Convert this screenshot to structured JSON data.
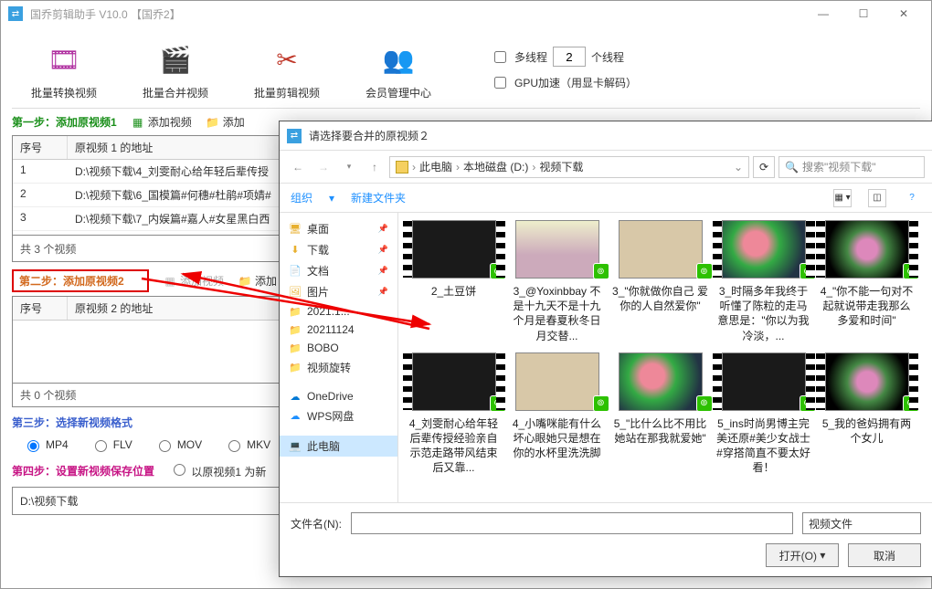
{
  "main_title": "国乔剪辑助手 V10.0   【国乔2】",
  "win_btns": {
    "min": "—",
    "max": "☐",
    "close": "✕"
  },
  "tools": [
    {
      "label": "批量转换视频",
      "icon": "🎞"
    },
    {
      "label": "批量合并视频",
      "icon": "🎬"
    },
    {
      "label": "批量剪辑视频",
      "icon": "✂"
    },
    {
      "label": "会员管理中心",
      "icon": "👥"
    }
  ],
  "options": {
    "multithread": "多线程",
    "thread_count": "2",
    "thread_unit": "个线程",
    "gpu": "GPU加速（用显卡解码）"
  },
  "step1": {
    "label": "第一步：添加原视频1",
    "add": "添加视频",
    "addfolder": "添加"
  },
  "table1": {
    "col_num": "序号",
    "col_addr": "原视频 1 的地址",
    "rows": [
      {
        "n": "1",
        "addr": "D:\\视频下载\\4_刘雯耐心给年轻后辈传授"
      },
      {
        "n": "2",
        "addr": "D:\\视频下载\\6_国模篇#何穗#杜鹃#项婧#"
      },
      {
        "n": "3",
        "addr": "D:\\视频下载\\7_内娱篇#嘉人#女星黑白西"
      }
    ],
    "footer": "共 3 个视频",
    "footer_chk": "添加"
  },
  "step2": {
    "label": "第二步：添加原视频2",
    "add": "添加视频",
    "addfolder": "添加"
  },
  "table2": {
    "col_num": "序号",
    "col_addr": "原视频 2 的地址",
    "footer": "共 0 个视频"
  },
  "step3": {
    "label": "第三步：选择新视频格式"
  },
  "formats": [
    "MP4",
    "FLV",
    "MOV",
    "MKV"
  ],
  "step4": {
    "label": "第四步：设置新视频保存位置",
    "opt": "以原视频1 为新"
  },
  "output_path": "D:\\视频下载",
  "dialog": {
    "title": "请选择要合并的原视频２",
    "crumbs": [
      "此电脑",
      "本地磁盘 (D:)",
      "视频下载"
    ],
    "search_placeholder": "搜索\"视频下载\"",
    "organize": "组织",
    "new_folder": "新建文件夹",
    "sidebar": [
      {
        "label": "桌面",
        "icon": "🖥",
        "pin": true
      },
      {
        "label": "下载",
        "icon": "⬇",
        "pin": true
      },
      {
        "label": "文档",
        "icon": "📄",
        "pin": true
      },
      {
        "label": "图片",
        "icon": "🖼",
        "pin": true
      },
      {
        "label": "2021.1...",
        "icon": "📁"
      },
      {
        "label": "20211124",
        "icon": "📁"
      },
      {
        "label": "BOBO",
        "icon": "📁"
      },
      {
        "label": "视频旋转",
        "icon": "📁"
      },
      {
        "label": "OneDrive",
        "icon": "☁",
        "cls": "si-onedrive",
        "gap": true
      },
      {
        "label": "WPS网盘",
        "icon": "☁",
        "cls": "si-wps"
      },
      {
        "label": "此电脑",
        "icon": "💻",
        "cls": "si-pc",
        "sel": true,
        "gap": true
      }
    ],
    "files": [
      {
        "name": "2_土豆饼",
        "cls": "dark"
      },
      {
        "name": "3_@Yoxinbbay 不是十九天不是十九个月是春夏秋冬日月交替...",
        "cls": "pink no-strip"
      },
      {
        "name": "3_\"你就做你自己 爱你的人自然爱你\"",
        "cls": "light no-strip"
      },
      {
        "name": "3_时隔多年我终于听懂了陈粒的走马意思是：\"你以为我冷淡，...",
        "cls": "flowers"
      },
      {
        "name": "4_\"你不能一句对不起就说带走我那么多爱和时间\"",
        "cls": "flowers2"
      },
      {
        "name": "4_刘雯耐心给年轻后辈传授经验亲自示范走路带风结束后又靠...",
        "cls": "dark"
      },
      {
        "name": "4_小嘴咪能有什么坏心眼她只是想在你的水杯里洗洗脚",
        "cls": "light no-strip"
      },
      {
        "name": "5_\"比什么比不用比她站在那我就爱她\"",
        "cls": "flowers no-strip"
      },
      {
        "name": "5_ins时尚男博主完美还原#美少女战士#穿搭简直不要太好看！",
        "cls": "dark"
      },
      {
        "name": "5_我的爸妈拥有两个女儿",
        "cls": "flowers2"
      }
    ],
    "filename_label": "文件名(N):",
    "filter": "视频文件",
    "open": "打开(O)",
    "cancel": "取消"
  }
}
